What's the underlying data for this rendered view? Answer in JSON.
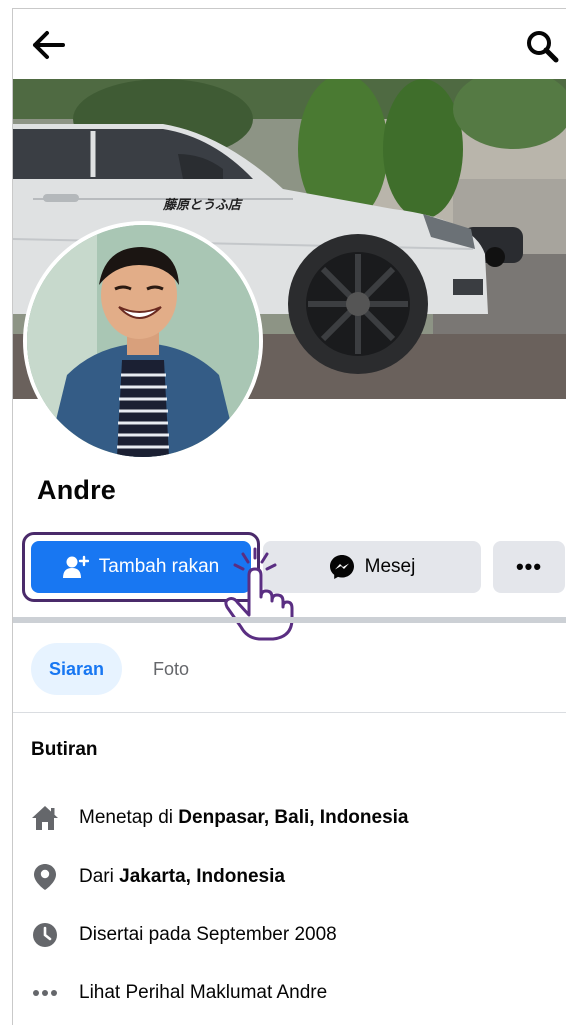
{
  "profile": {
    "name": "Andre"
  },
  "actions": {
    "add_friend_label": "Tambah rakan",
    "message_label": "Mesej",
    "more_label": "•••"
  },
  "tabs": [
    {
      "label": "Siaran",
      "active": true
    },
    {
      "label": "Foto",
      "active": false
    }
  ],
  "details": {
    "title": "Butiran",
    "rows": [
      {
        "icon": "home-icon",
        "prefix": "Menetap di ",
        "bold": "Denpasar, Bali, Indonesia"
      },
      {
        "icon": "location-pin-icon",
        "prefix": "Dari ",
        "bold": "Jakarta, Indonesia"
      },
      {
        "icon": "clock-icon",
        "prefix": "Disertai pada September 2008",
        "bold": ""
      },
      {
        "icon": "more-dots-icon",
        "prefix": "Lihat Perihal Maklumat Andre",
        "bold": ""
      }
    ]
  },
  "cover": {
    "sticker_text": "藤原とうふ店"
  },
  "colors": {
    "primary": "#1877f2",
    "secondary_button": "#e4e6eb",
    "active_tab_bg": "#e7f3ff",
    "highlight_outline": "#4a2a6a",
    "icon_gray": "#65676b"
  }
}
